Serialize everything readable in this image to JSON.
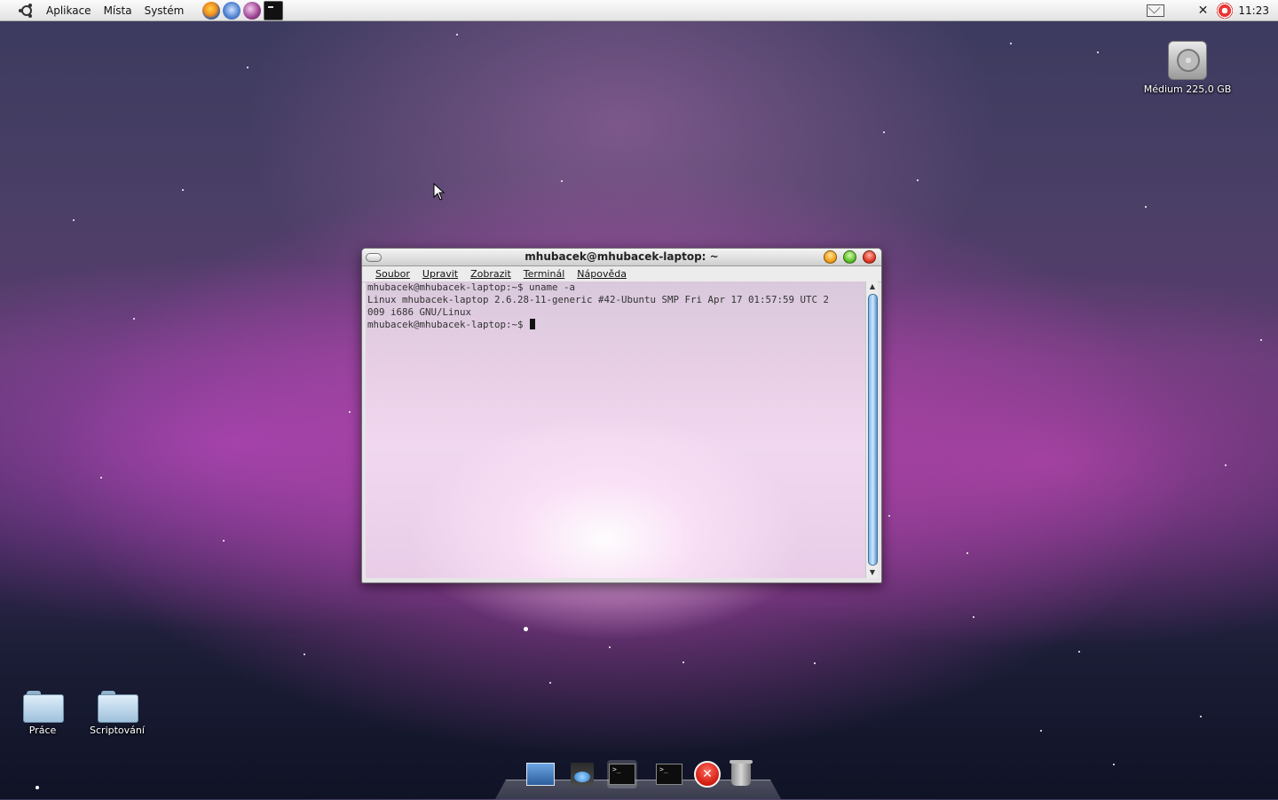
{
  "top_panel": {
    "menus": [
      "Aplikace",
      "Místa",
      "Systém"
    ],
    "launchers": [
      "firefox-icon",
      "thunderbird-icon",
      "pidgin-icon",
      "terminal-icon"
    ],
    "clock": "11:23"
  },
  "desktop": {
    "drive_label": "Médium 225,0 GB",
    "folders": [
      "Práce",
      "Scriptování"
    ]
  },
  "terminal_window": {
    "title": "mhubacek@mhubacek-laptop: ~",
    "menu": [
      "Soubor",
      "Upravit",
      "Zobrazit",
      "Terminál",
      "Nápověda"
    ],
    "lines": [
      "mhubacek@mhubacek-laptop:~$ uname -a",
      "Linux mhubacek-laptop 2.6.28-11-generic #42-Ubuntu SMP Fri Apr 17 01:57:59 UTC 2",
      "009 i686 GNU/Linux",
      "mhubacek@mhubacek-laptop:~$ "
    ]
  },
  "dock": {
    "items": [
      "photo-viewer-icon",
      "video-editor-icon",
      "terminal-icon",
      "terminal-icon",
      "stop-icon",
      "trash-icon"
    ]
  },
  "colors": {
    "panel_bg": "#e8e8e8",
    "close_button": "#e33b27",
    "minimize_button": "#f3a21a",
    "maximize_button": "#5fc52b",
    "scroll_thumb": "#7fb6e6"
  }
}
